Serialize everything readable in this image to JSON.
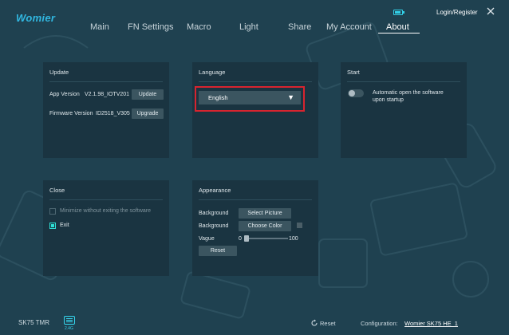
{
  "app": {
    "logo": "Womier"
  },
  "nav": {
    "items": [
      {
        "label": "Main"
      },
      {
        "label": "FN Settings"
      },
      {
        "label": "Macro"
      },
      {
        "label": "Light"
      },
      {
        "label": "Share"
      },
      {
        "label": "My Account"
      },
      {
        "label": "About",
        "active": true
      }
    ]
  },
  "header": {
    "login_label": "Login/Register",
    "battery_icon": "battery-icon",
    "close_icon": "close-icon"
  },
  "update": {
    "title": "Update",
    "app_version_label": "App Version",
    "app_version_value": "V2.1.98_IOTV201",
    "update_button": "Update",
    "firmware_label": "Firmware Version",
    "firmware_value": "ID2518_V305",
    "upgrade_button": "Upgrade"
  },
  "language": {
    "title": "Language",
    "selected": "English",
    "highlight_color": "#d8242f"
  },
  "start": {
    "title": "Start",
    "auto_open_line1": "Automatic open the software",
    "auto_open_line2": "upon startup",
    "auto_open_enabled": false
  },
  "close": {
    "title": "Close",
    "minimize_label": "Minimize without exiting the software",
    "minimize_checked": false,
    "exit_label": "Exit",
    "exit_checked": true
  },
  "appearance": {
    "title": "Appearance",
    "background_label_1": "Background",
    "select_picture_button": "Select Picture",
    "background_label_2": "Background",
    "choose_color_button": "Choose Color",
    "vague_label": "Vague",
    "vague_min": "0",
    "vague_max": "100",
    "vague_value": 0,
    "reset_button": "Reset"
  },
  "footer": {
    "device_name": "SK75 TMR",
    "connection_badge": "2.4G",
    "reset_label": "Reset",
    "config_label": "Configuration:",
    "config_value": "Womier SK75 HE_1"
  },
  "colors": {
    "background": "#1f4150",
    "panel": "#1a3441",
    "accent": "#31b7e0",
    "button": "#3b5560",
    "checkbox_active": "#2ee0d6"
  }
}
